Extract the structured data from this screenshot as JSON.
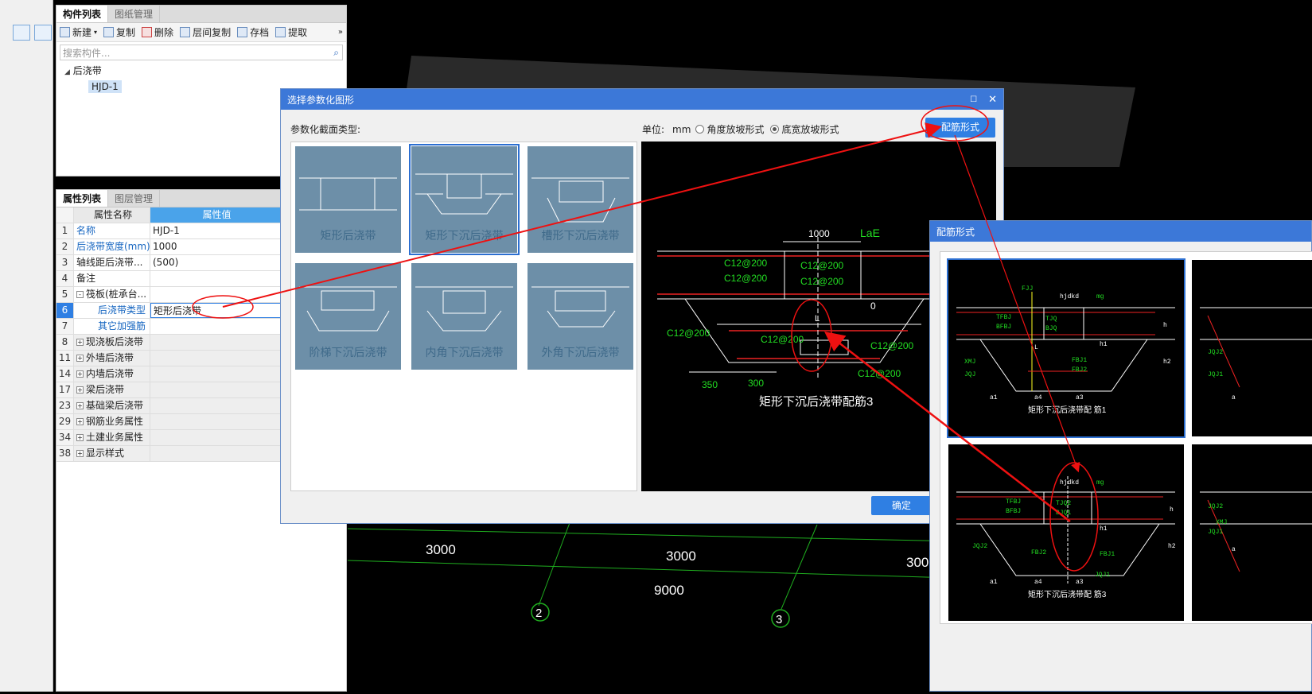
{
  "left_panel": {
    "tabs": [
      "构件列表",
      "图纸管理"
    ],
    "toolbar": [
      "新建",
      "复制",
      "删除",
      "层间复制",
      "存档",
      "提取"
    ],
    "search_placeholder": "搜索构件...",
    "tree_root": "后浇带",
    "tree_item": "HJD-1"
  },
  "prop_panel": {
    "tabs": [
      "属性列表",
      "图层管理"
    ],
    "header": {
      "name": "属性名称",
      "value": "属性值"
    },
    "rows": [
      {
        "num": "1",
        "name": "名称",
        "value": "HJD-1",
        "blue": true
      },
      {
        "num": "2",
        "name": "后浇带宽度(mm)",
        "value": "1000",
        "blue": true
      },
      {
        "num": "3",
        "name": "轴线距后浇带...",
        "value": "(500)",
        "blue": false
      },
      {
        "num": "4",
        "name": "备注",
        "value": "",
        "blue": false
      },
      {
        "num": "5",
        "name": "筏板(桩承台...",
        "value": "",
        "blue": false,
        "expand": "-"
      },
      {
        "num": "6",
        "name": "后浇带类型",
        "value": "矩形后浇带",
        "blue": true,
        "indent": true,
        "selected": true
      },
      {
        "num": "7",
        "name": "其它加强筋",
        "value": "",
        "blue": true,
        "indent": true
      },
      {
        "num": "8",
        "name": "现浇板后浇带",
        "value": "",
        "expand": "+"
      },
      {
        "num": "11",
        "name": "外墙后浇带",
        "value": "",
        "expand": "+"
      },
      {
        "num": "14",
        "name": "内墙后浇带",
        "value": "",
        "expand": "+"
      },
      {
        "num": "17",
        "name": "梁后浇带",
        "value": "",
        "expand": "+"
      },
      {
        "num": "23",
        "name": "基础梁后浇带",
        "value": "",
        "expand": "+"
      },
      {
        "num": "29",
        "name": "钢筋业务属性",
        "value": "",
        "expand": "+"
      },
      {
        "num": "34",
        "name": "土建业务属性",
        "value": "",
        "expand": "+"
      },
      {
        "num": "38",
        "name": "显示样式",
        "value": "",
        "expand": "+"
      }
    ]
  },
  "cad": {
    "dims": [
      "3000",
      "3000",
      "300",
      "9000"
    ],
    "axes": [
      "2",
      "3"
    ]
  },
  "dialog1": {
    "title": "选择参数化图形",
    "section_label": "参数化截面类型:",
    "unit_label": "单位:",
    "unit_value": "mm",
    "radio1": "角度放坡形式",
    "radio2": "底宽放坡形式",
    "rebar_button": "配筋形式",
    "ok_button": "确定",
    "shapes": [
      "矩形后浇带",
      "矩形下沉后浇带",
      "槽形下沉后浇带",
      "阶梯下沉后浇带",
      "内角下沉后浇带",
      "外角下沉后浇带"
    ],
    "preview": {
      "caption": "矩形下沉后浇带配筋3",
      "labels": [
        "1000",
        "LaE",
        "C12@200",
        "C12@200",
        "C12@200",
        "C12@200",
        "0",
        "L",
        "C12@200",
        "C12@200",
        "C12@200",
        "C12@200",
        "350",
        "300"
      ]
    }
  },
  "dialog2": {
    "title": "配筋形式",
    "caption1": "矩形下沉后浇带配 筋1",
    "caption2": "矩形下沉后浇带配 筋3",
    "labels1": [
      "FJJ",
      "hjdkd",
      "mg",
      "TFBJ",
      "BFBJ",
      "TJQ",
      "BJQ",
      "h",
      "h1",
      "h2",
      "L",
      "XMJ",
      "JQJ",
      "FBJ1",
      "FBJ2",
      "a1",
      "a4",
      "a3"
    ],
    "labels2": [
      "hjdkd",
      "mg",
      "TFBJ",
      "BFBJ",
      "TJQ2",
      "BJQ1",
      "h",
      "h1",
      "h2",
      "JQJ2",
      "FBJ2",
      "FBJ1",
      "JQJ1",
      "a1",
      "a4",
      "a3"
    ],
    "side_labels": [
      "JQJ2",
      "JQJ1",
      "XMJ",
      "a"
    ]
  }
}
